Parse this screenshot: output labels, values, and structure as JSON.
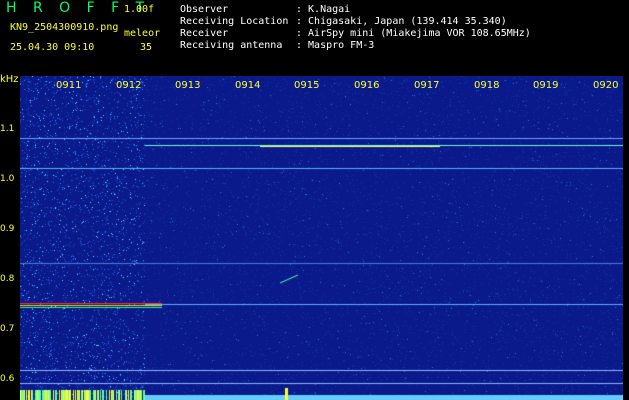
{
  "header": {
    "logo": "H R O F F T",
    "version": "1.00f",
    "filename": "KN9_2504300910.png",
    "meteor_label": "meleor",
    "datetime": "25.04.30 09:10",
    "count": "35"
  },
  "info": {
    "observer_label": "Observer",
    "observer_value": ": K.Nagai",
    "location_label": "Receiving Location",
    "location_value": ": Chigasaki, Japan (139.414 35.340)",
    "receiver_label": "Receiver",
    "receiver_value": ": AirSpy mini (Miakejima VOR 108.65MHz)",
    "antenna_label": "Receiving antenna",
    "antenna_value": ": Maspro FM-3"
  },
  "axis": {
    "unit": "kHz",
    "x_ticks": [
      "0911",
      "0912",
      "0913",
      "0914",
      "0915",
      "0916",
      "0917",
      "0918",
      "0919",
      "0920"
    ],
    "y_ticks": [
      "1.1",
      "1.0",
      "0.9",
      "0.8",
      "0.7",
      "0.6"
    ]
  },
  "colors": {
    "background": "#0a1a8a",
    "accent": "#ffff33",
    "logo": "#00ff66"
  }
}
